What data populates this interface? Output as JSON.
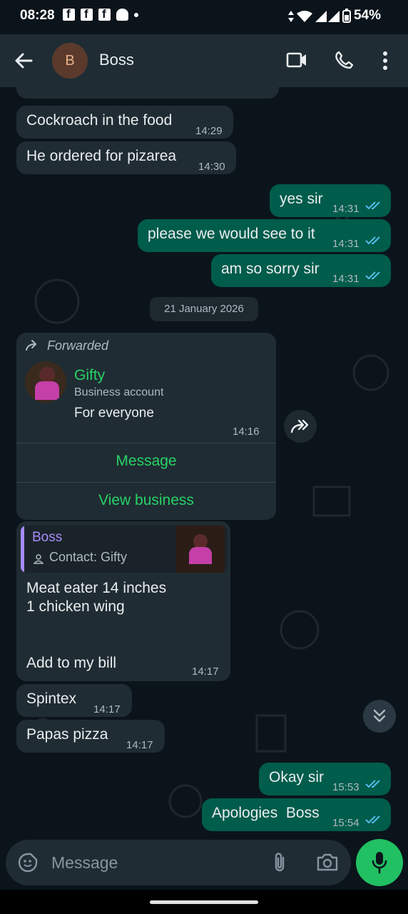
{
  "status_bar": {
    "time": "08:28",
    "battery": "54%",
    "icons": [
      "facebook-icon",
      "facebook-icon",
      "facebook-icon",
      "snapchat-icon",
      "dot-icon",
      "data-icon",
      "wifi-icon",
      "signal-icon",
      "signal-icon",
      "battery-icon"
    ]
  },
  "header": {
    "avatar_letter": "B",
    "contact_name": "Boss",
    "icons": [
      "back-arrow-icon",
      "video-call-icon",
      "phone-call-icon",
      "more-options-icon"
    ]
  },
  "messages": {
    "partial_time": "14:29",
    "m1": {
      "text": "Cockroach in the food",
      "time": "14:29"
    },
    "m2": {
      "text": "He ordered for pizarea",
      "time": "14:30"
    },
    "m3": {
      "text": "yes sir",
      "time": "14:31"
    },
    "m4": {
      "text": "please we would see to it",
      "time": "14:31"
    },
    "m5": {
      "text": "am so sorry sir",
      "time": "14:31"
    },
    "date_divider": "21 January 2026",
    "forwarded": {
      "label": "Forwarded",
      "contact_name": "Gifty",
      "contact_type": "Business account",
      "body": "For everyone",
      "time": "14:16",
      "button_message": "Message",
      "button_view_business": "View business"
    },
    "reply": {
      "quote_name": "Boss",
      "quote_sub": "Contact: Gifty",
      "line1": "Meat eater 14 inches",
      "line2": "1 chicken wing",
      "line3": "Add to my bill",
      "time": "14:17"
    },
    "m6": {
      "text": "Spintex",
      "time": "14:17"
    },
    "m7": {
      "text": "Papas pizza",
      "time": "14:17"
    },
    "m8": {
      "text": "Okay sir",
      "time": "15:53"
    },
    "m9": {
      "text": "Apologies  Boss",
      "time": "15:54"
    }
  },
  "composer": {
    "placeholder": "Message",
    "icons": [
      "emoji-sticker-icon",
      "attach-icon",
      "camera-icon",
      "mic-icon"
    ]
  },
  "colors": {
    "incoming_bubble": "#202c33",
    "outgoing_bubble": "#005c4b",
    "accent_green": "#25d366",
    "read_ticks": "#53bdeb",
    "background": "#0b141a"
  }
}
